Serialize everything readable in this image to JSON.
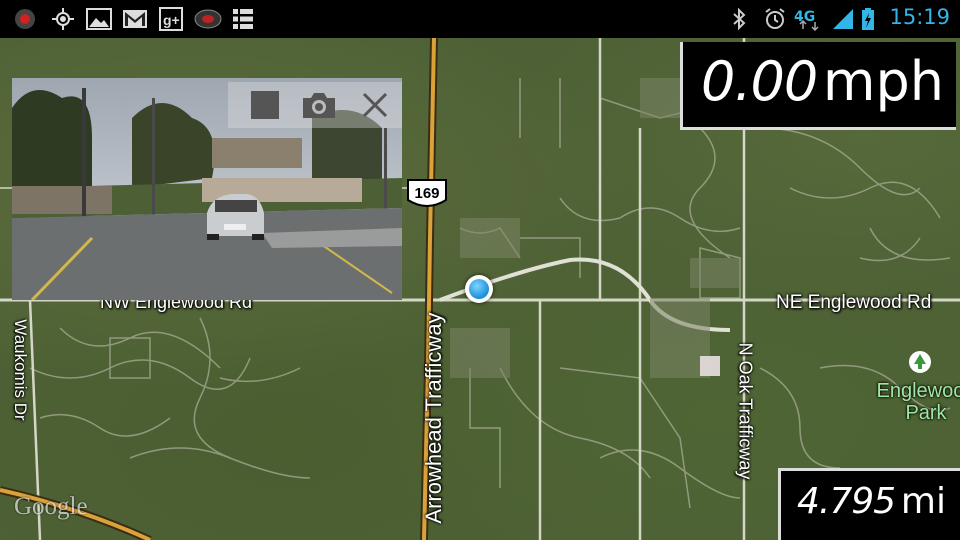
{
  "status_bar": {
    "left_icons": [
      "record-icon",
      "gps-icon",
      "gallery-icon",
      "gmail-icon",
      "google-plus-icon",
      "dashcam-app-icon",
      "list-icon"
    ],
    "right_icons": [
      "bluetooth-icon",
      "alarm-icon",
      "4g-lte-icon",
      "signal-icon",
      "battery-charging-icon"
    ],
    "network_label": "4G",
    "time": "15:19"
  },
  "speed": {
    "value": "0.00",
    "unit": "mph"
  },
  "distance": {
    "value": "4.795",
    "unit": "mi"
  },
  "map": {
    "road_labels": {
      "arrowhead": "Arrowhead Trafficway",
      "ne_englewood": "NE Englewood Rd",
      "nw_englewood": "NW Englewood Rd",
      "oak": "N Oak Trafficway",
      "waukomis": "Waukomis Dr"
    },
    "route_shield": "169",
    "park_label": "Englewood Park",
    "attribution": "Google"
  },
  "camera": {
    "controls": [
      "stop-icon",
      "camera-icon",
      "close-icon"
    ]
  },
  "colors": {
    "clock": "#33b5e5",
    "location_dot": "#1a8fd8",
    "highway": "#d9a23a",
    "park_label": "#9fe7a4"
  }
}
